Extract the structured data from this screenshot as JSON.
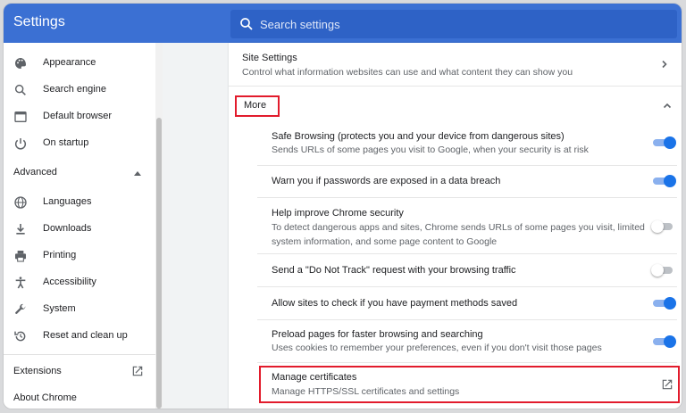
{
  "header": {
    "title": "Settings",
    "search_placeholder": "Search settings"
  },
  "sidebar": {
    "items": [
      {
        "label": "Appearance",
        "icon": "palette-icon"
      },
      {
        "label": "Search engine",
        "icon": "search-icon"
      },
      {
        "label": "Default browser",
        "icon": "browser-icon"
      },
      {
        "label": "On startup",
        "icon": "power-icon"
      }
    ],
    "advanced_label": "Advanced",
    "advanced_items": [
      {
        "label": "Languages",
        "icon": "globe-icon"
      },
      {
        "label": "Downloads",
        "icon": "download-icon"
      },
      {
        "label": "Printing",
        "icon": "printer-icon"
      },
      {
        "label": "Accessibility",
        "icon": "accessibility-icon"
      },
      {
        "label": "System",
        "icon": "wrench-icon"
      },
      {
        "label": "Reset and clean up",
        "icon": "restore-icon"
      }
    ],
    "extensions_label": "Extensions",
    "about_label": "About Chrome"
  },
  "main": {
    "site_settings": {
      "title": "Site Settings",
      "desc": "Control what information websites can use and what content they can show you"
    },
    "more_label": "More",
    "settings": [
      {
        "title": "Safe Browsing (protects you and your device from dangerous sites)",
        "desc": "Sends URLs of some pages you visit to Google, when your security is at risk",
        "on": true
      },
      {
        "title": "Warn you if passwords are exposed in a data breach",
        "on": true
      },
      {
        "title": "Help improve Chrome security",
        "desc": "To detect dangerous apps and sites, Chrome sends URLs of some pages you visit, limited",
        "desc2": "system information, and some page content to Google",
        "on": false
      },
      {
        "title": "Send a \"Do Not Track\" request with your browsing traffic",
        "on": false
      },
      {
        "title": "Allow sites to check if you have payment methods saved",
        "on": true
      },
      {
        "title": "Preload pages for faster browsing and searching",
        "desc": "Uses cookies to remember your preferences, even if you don't visit those pages",
        "on": true
      }
    ],
    "certificates": {
      "title": "Manage certificates",
      "desc": "Manage HTTPS/SSL certificates and settings"
    }
  },
  "colors": {
    "header_blue": "#3b70d3",
    "toggle_on": "#1a73e8",
    "highlight_red": "#e21b2c"
  }
}
